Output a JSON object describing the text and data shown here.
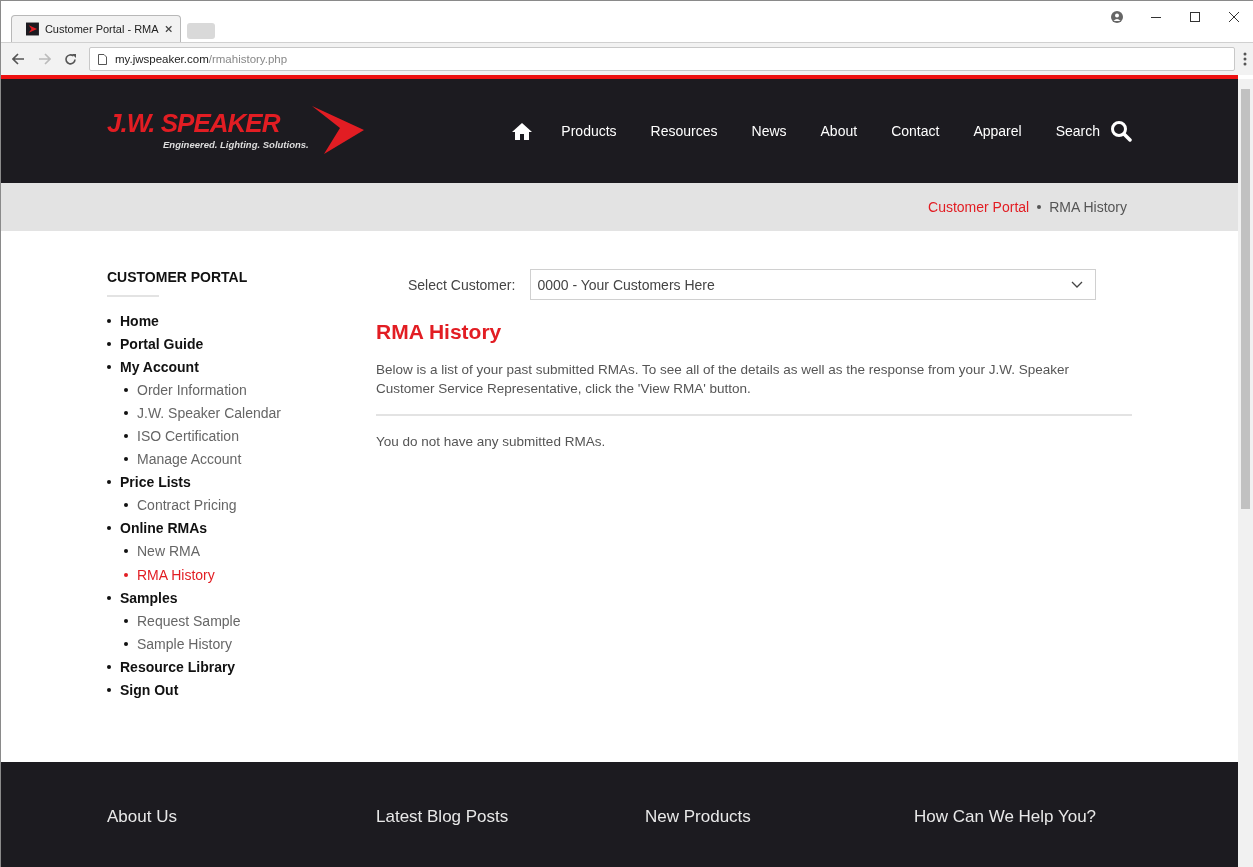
{
  "browser": {
    "tab_title": "Customer Portal - RMA",
    "url_host": "my.jwspeaker.com",
    "url_path": "/rmahistory.php"
  },
  "header": {
    "logo_name": "J.W. SPEAKER",
    "logo_tagline": "Engineered. Lighting. Solutions.",
    "nav": [
      "Products",
      "Resources",
      "News",
      "About",
      "Contact",
      "Apparel"
    ],
    "search_label": "Search"
  },
  "breadcrumb": [
    {
      "label": "Customer Portal",
      "kind": "link"
    },
    {
      "label": "RMA History",
      "kind": "current"
    }
  ],
  "sidebar": {
    "title": "CUSTOMER PORTAL",
    "items": [
      {
        "label": "Home",
        "selected": false
      },
      {
        "label": "Portal Guide",
        "selected": false
      },
      {
        "label": "My Account",
        "selected": false,
        "children": [
          {
            "label": "Order Information",
            "selected": false
          },
          {
            "label": "J.W. Speaker Calendar",
            "selected": false
          },
          {
            "label": "ISO Certification",
            "selected": false
          },
          {
            "label": "Manage Account",
            "selected": false
          }
        ]
      },
      {
        "label": "Price Lists",
        "selected": false,
        "children": [
          {
            "label": "Contract Pricing",
            "selected": false
          }
        ]
      },
      {
        "label": "Online RMAs",
        "selected": false,
        "children": [
          {
            "label": "New RMA",
            "selected": false
          },
          {
            "label": "RMA History",
            "selected": true
          }
        ]
      },
      {
        "label": "Samples",
        "selected": false,
        "children": [
          {
            "label": "Request Sample",
            "selected": false
          },
          {
            "label": "Sample History",
            "selected": false
          }
        ]
      },
      {
        "label": "Resource Library",
        "selected": false
      },
      {
        "label": "Sign Out",
        "selected": false
      }
    ]
  },
  "main": {
    "select_label": "Select Customer:",
    "select_value": "0000 - Your Customers Here",
    "title": "RMA History",
    "intro": "Below is a list of your past submitted RMAs. To see all of the details as well as the response from your J.W. Speaker Customer Service Representative, click the 'View RMA' button.",
    "empty_message": "You do not have any submitted RMAs."
  },
  "footer": {
    "headings": [
      "About Us",
      "Latest Blog Posts",
      "New Products",
      "How Can We Help You?"
    ]
  }
}
